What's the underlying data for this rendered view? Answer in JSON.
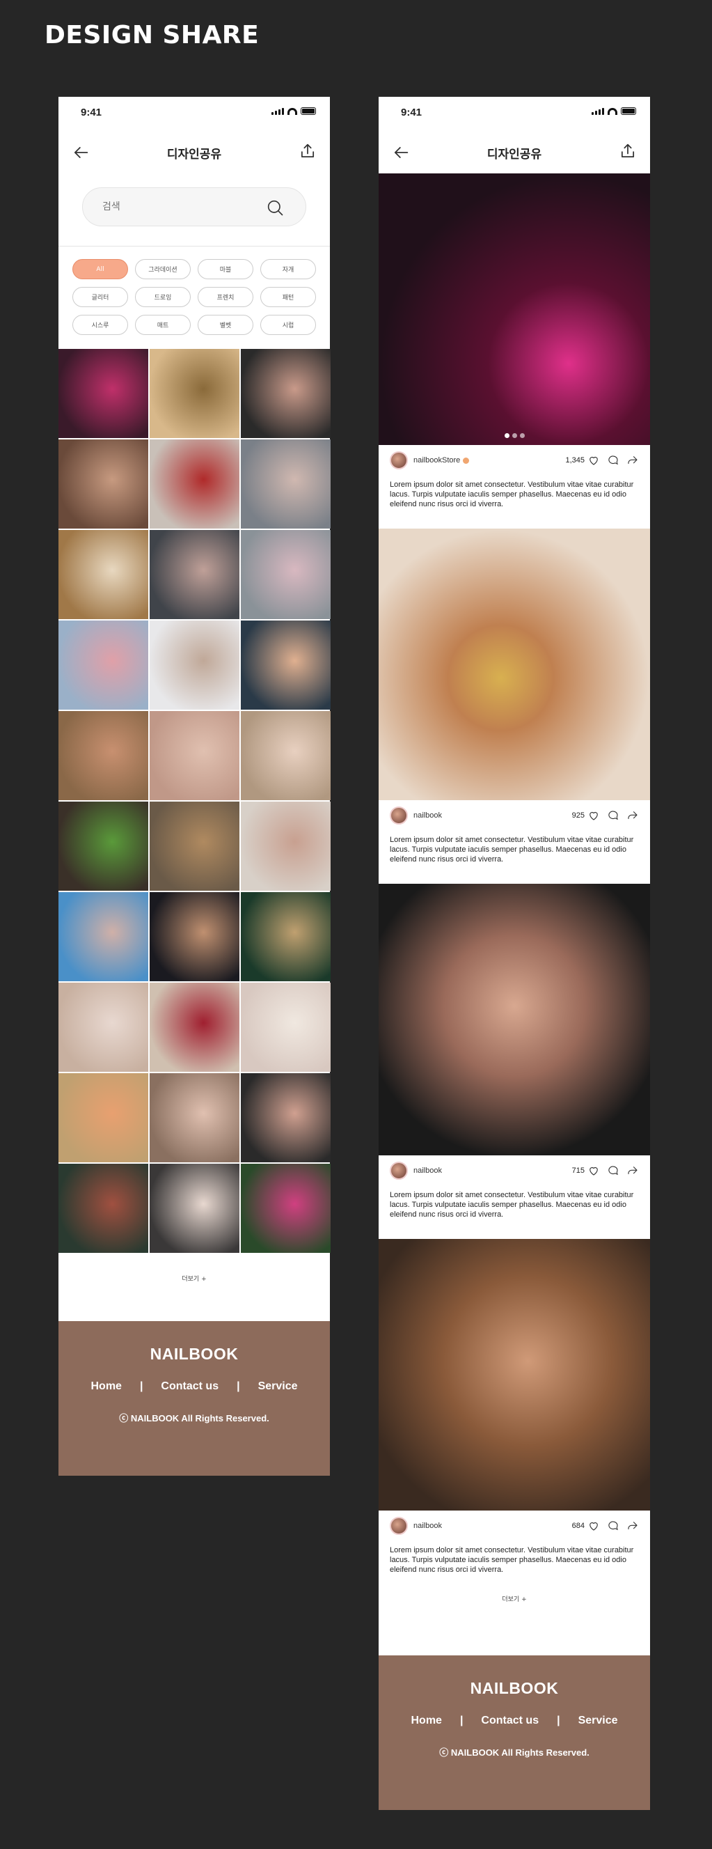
{
  "heading": "DESIGN SHARE",
  "status": {
    "time": "9:41"
  },
  "appbar": {
    "title": "디자인공유"
  },
  "search": {
    "placeholder": "검색"
  },
  "chips": [
    "All",
    "그라데이션",
    "마블",
    "자개",
    "글리터",
    "드로잉",
    "프렌치",
    "패턴",
    "시스루",
    "매트",
    "벨벳",
    "시럽"
  ],
  "active_chip": "All",
  "more_label": "더보기 +",
  "footer": {
    "brand": "NAILBOOK",
    "links": [
      "Home",
      "Contact us",
      "Service"
    ],
    "copyright": "ⓒ NAILBOOK All Rights Reserved."
  },
  "posts": [
    {
      "handle": "nailbookStore",
      "likes": "1,345",
      "caption": "Lorem ipsum dolor sit amet consectetur. Vestibulum vitae vitae curabitur lacus. Turpis vulputate iaculis semper phasellus. Maecenas eu id odio eleifend nunc risus orci id viverra."
    },
    {
      "handle": "nailbook",
      "likes": "925",
      "caption": "Lorem ipsum dolor sit amet consectetur. Vestibulum vitae vitae curabitur lacus. Turpis vulputate iaculis semper phasellus. Maecenas eu id odio eleifend nunc risus orci id viverra."
    },
    {
      "handle": "nailbook",
      "likes": "715",
      "caption": "Lorem ipsum dolor sit amet consectetur. Vestibulum vitae vitae curabitur lacus. Turpis vulputate iaculis semper phasellus. Maecenas eu id odio eleifend nunc risus orci id viverra."
    },
    {
      "handle": "nailbook",
      "likes": "684",
      "caption": "Lorem ipsum dolor sit amet consectetur. Vestibulum vitae vitae curabitur lacus. Turpis vulputate iaculis semper phasellus. Maecenas eu id odio eleifend nunc risus orci id viverra."
    }
  ],
  "colors": {
    "background": "#262626",
    "accent": "#f7a98a",
    "footer": "#8d6b5b"
  },
  "icons": [
    "back-arrow-icon",
    "share-icon",
    "search-icon",
    "heart-icon",
    "comment-icon",
    "send-icon",
    "signal-icon",
    "wifi-icon",
    "battery-icon"
  ]
}
